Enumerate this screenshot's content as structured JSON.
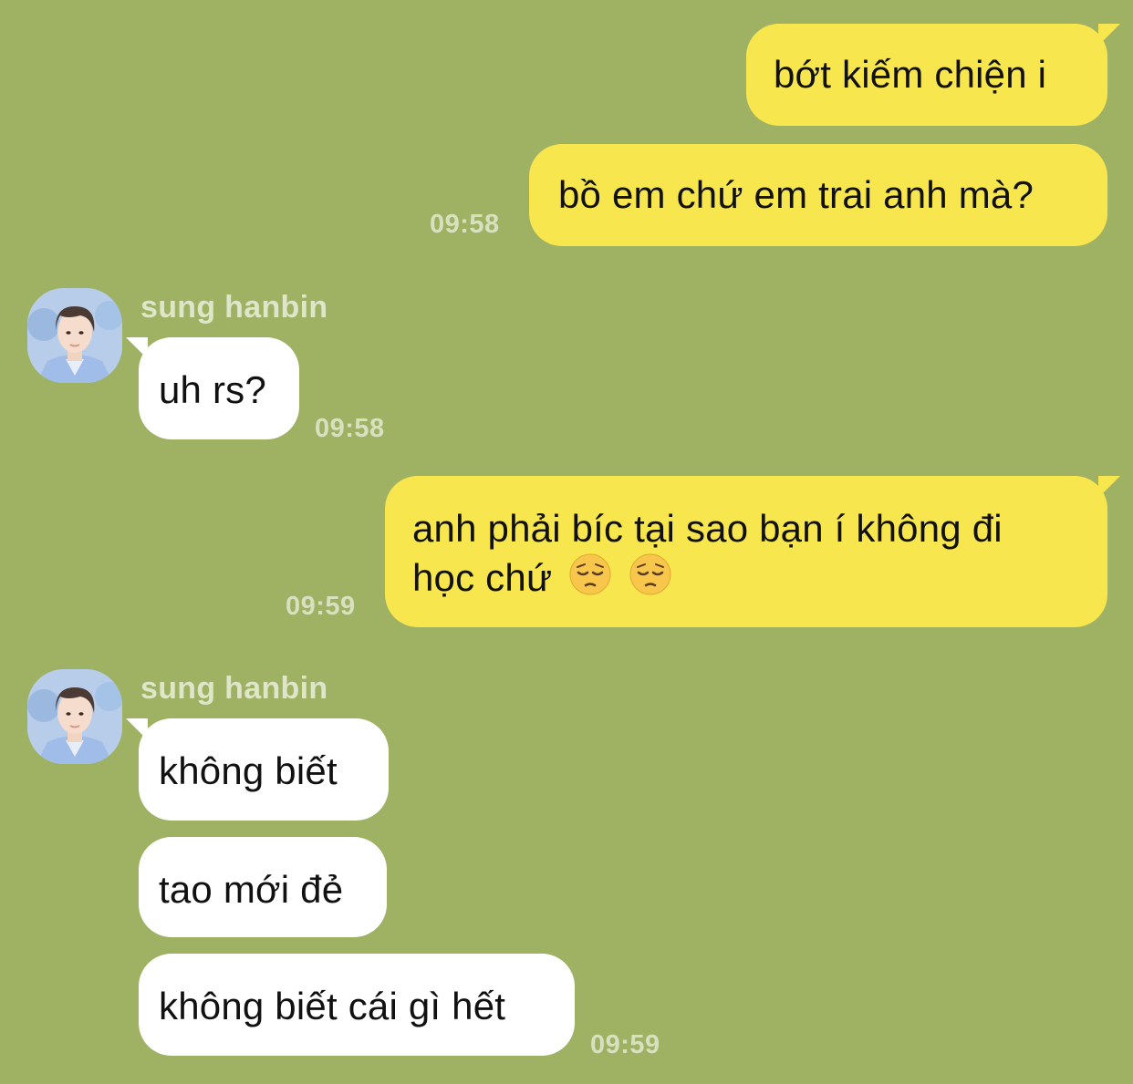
{
  "colors": {
    "background": "#9fb264",
    "mine_bubble": "#f8e64e",
    "theirs_bubble": "#ffffff",
    "time_text": "#d9e0c0",
    "sender_text": "#dfe5c8"
  },
  "messages": {
    "m1": {
      "text": "bớt kiếm chiện i"
    },
    "m2": {
      "text": "bồ em chứ em trai anh mà?",
      "time": "09:58"
    },
    "g1": {
      "sender": "sung hanbin",
      "text": "uh rs?",
      "time": "09:58"
    },
    "m3": {
      "line1": "anh phải bíc tại sao bạn í không đi",
      "line2": "học chứ",
      "emoji": "pensive-face",
      "time": "09:59"
    },
    "g2": {
      "sender": "sung hanbin",
      "text1": "không biết",
      "text2": "tao mới đẻ",
      "text3": "không biết cái gì hết",
      "time": "09:59"
    }
  }
}
